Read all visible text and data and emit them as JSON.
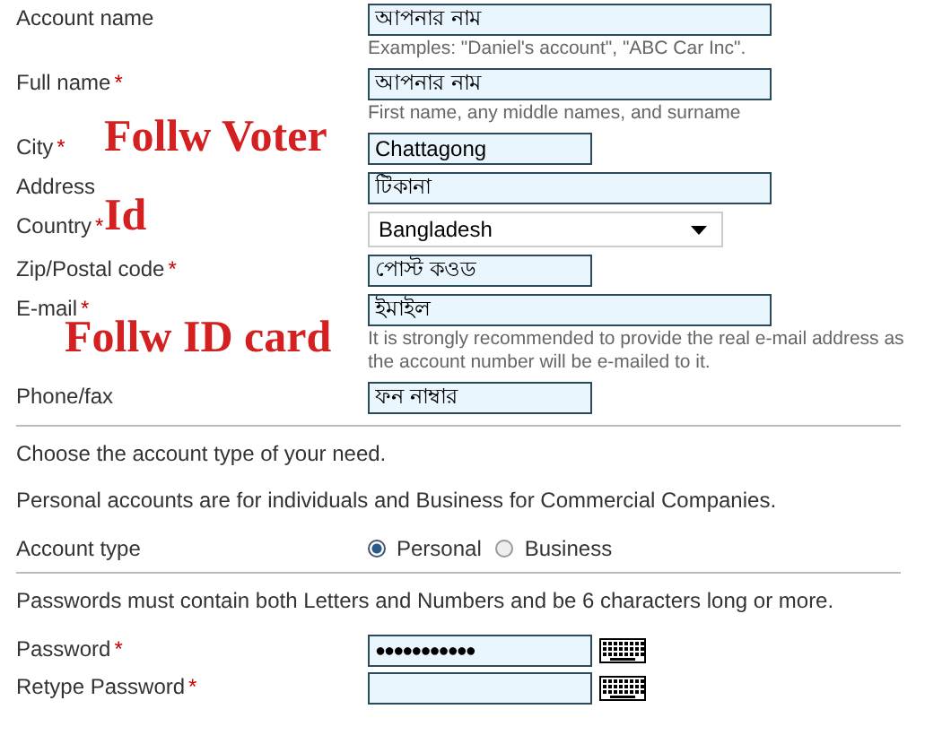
{
  "fields": [
    {
      "kind": "text",
      "label": "Account name",
      "value": "আপনার নাম",
      "hint": "Examples: \"Daniel's account\", \"ABC Car Inc\"."
    },
    {
      "kind": "text",
      "label": "Full name",
      "mark": "*",
      "value": "আপনার নাম",
      "hint": "First name, any middle names, and surname"
    },
    {
      "kind": "text",
      "label": "City",
      "mark": "*",
      "value": "Chattagong"
    },
    {
      "kind": "text",
      "label": "Address",
      "value": "টিকানা"
    },
    {
      "kind": "select",
      "label": "Country",
      "mark": "*",
      "value": "Bangladesh"
    },
    {
      "kind": "text",
      "label": "Zip/Postal code",
      "mark": "*",
      "value": "পোস্ট কওড"
    },
    {
      "kind": "text",
      "label": "E-mail",
      "mark": "*",
      "value": "ইমাইল",
      "hint": "It is strongly recommended to provide the real e-mail address as the account number will be e-mailed to it."
    },
    {
      "kind": "text",
      "label": "Phone/fax",
      "value": "ফন নাম্বার"
    }
  ],
  "intro": [
    "Choose the account type of your need.",
    "Personal accounts are for individuals and Business for Commercial Companies."
  ],
  "account_type": {
    "label": "Account type",
    "options": [
      {
        "label": "Personal",
        "selected": true
      },
      {
        "label": "Business",
        "selected": false
      }
    ]
  },
  "password_note": "Passwords must contain both Letters and Numbers and be 6 characters long or more.",
  "password_fields": [
    {
      "label": "Password",
      "mark": "*",
      "value": "●●●●●●●●●●●"
    },
    {
      "label": "Retype Password",
      "mark": "*"
    }
  ],
  "annotations": [
    "Follw Voter",
    "Id",
    "Follw ID card"
  ]
}
